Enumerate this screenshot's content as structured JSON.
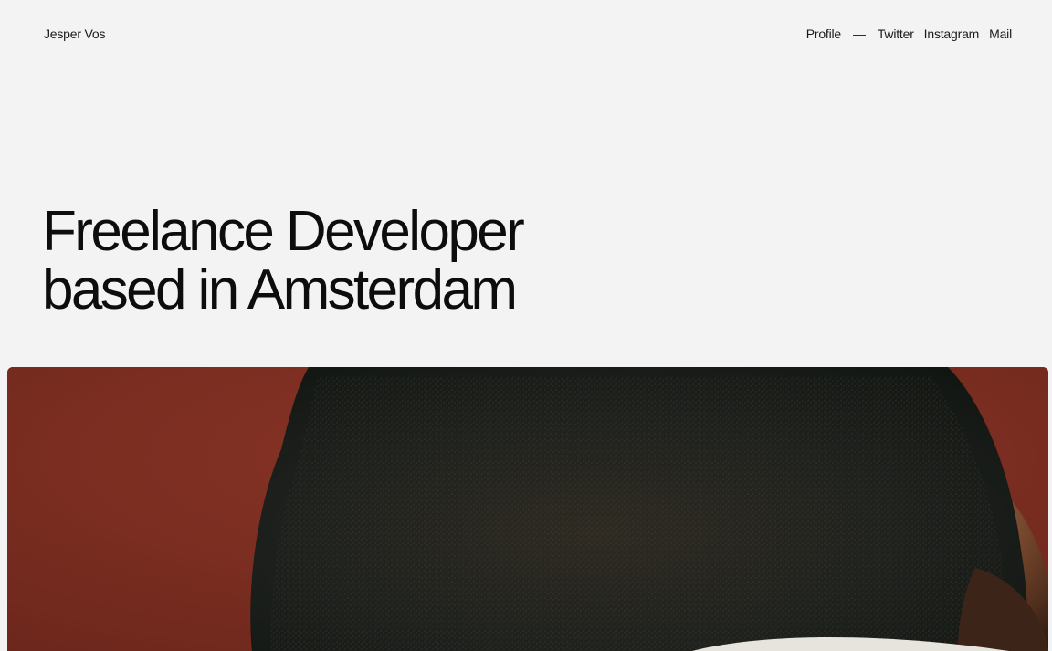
{
  "header": {
    "brand": "Jesper Vos",
    "nav": {
      "profile": "Profile",
      "separator": "—",
      "twitter": "Twitter",
      "instagram": "Instagram",
      "mail": "Mail"
    }
  },
  "hero": {
    "line1": "Freelance Developer",
    "line2": "based in Amsterdam"
  },
  "colors": {
    "background": "#f3f3f3",
    "text": "#111111",
    "photo_backdrop": "#7d2e22",
    "hair": "#1c1f1c"
  }
}
